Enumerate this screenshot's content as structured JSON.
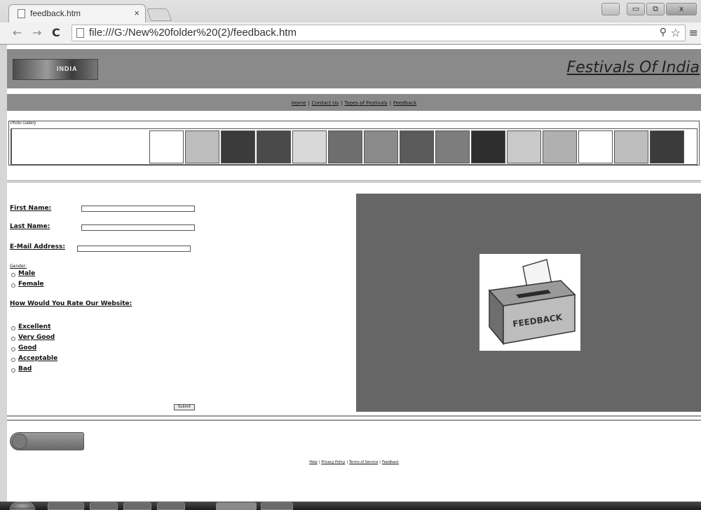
{
  "browser": {
    "tab_title": "feedback.htm",
    "tab_close": "×",
    "url": "file:///G:/New%20folder%20(2)/feedback.htm",
    "back_glyph": "←",
    "forward_glyph": "→",
    "reload_glyph": "C",
    "zoom_glyph": "⚲",
    "star_glyph": "☆",
    "menu_glyph": "≡",
    "window_minimize": "▭",
    "window_maximize": "⧉",
    "window_close": "x"
  },
  "site": {
    "logo_text": "INDIA",
    "title": "Festivals Of India"
  },
  "nav": {
    "items": [
      "Home",
      "Contact Us",
      "Types of Festivals",
      "Feedback"
    ],
    "separator": "|"
  },
  "gallery": {
    "label": "Photo Gallery",
    "thumbnail_colors": [
      "#ffffff",
      "#bdbdbd",
      "#3b3b3b",
      "#4a4a4a",
      "#d9d9d9",
      "#6e6e6e",
      "#8a8a8a",
      "#5a5a5a",
      "#7d7d7d",
      "#2e2e2e",
      "#c9c9c9",
      "#b0b0b0",
      "#ffffff",
      "#bdbdbd",
      "#3b3b3b"
    ]
  },
  "form": {
    "first_name_label": "First Name:",
    "last_name_label": "Last Name:",
    "email_label": "E-Mail Address:",
    "gender_label": "Gender:",
    "gender_options": [
      "Male",
      "Female"
    ],
    "rating_label": "How Would You Rate Our Website:",
    "rating_options": [
      "Excellent",
      "Very Good",
      "Good",
      "Acceptable",
      "Bad"
    ],
    "submit_label": "Submit"
  },
  "feedback_image": {
    "caption": "FEEDBACK"
  },
  "footer": {
    "links": [
      "Help",
      "Privacy Policy",
      "Terms of Service",
      "Feedback"
    ],
    "separator": "|"
  }
}
